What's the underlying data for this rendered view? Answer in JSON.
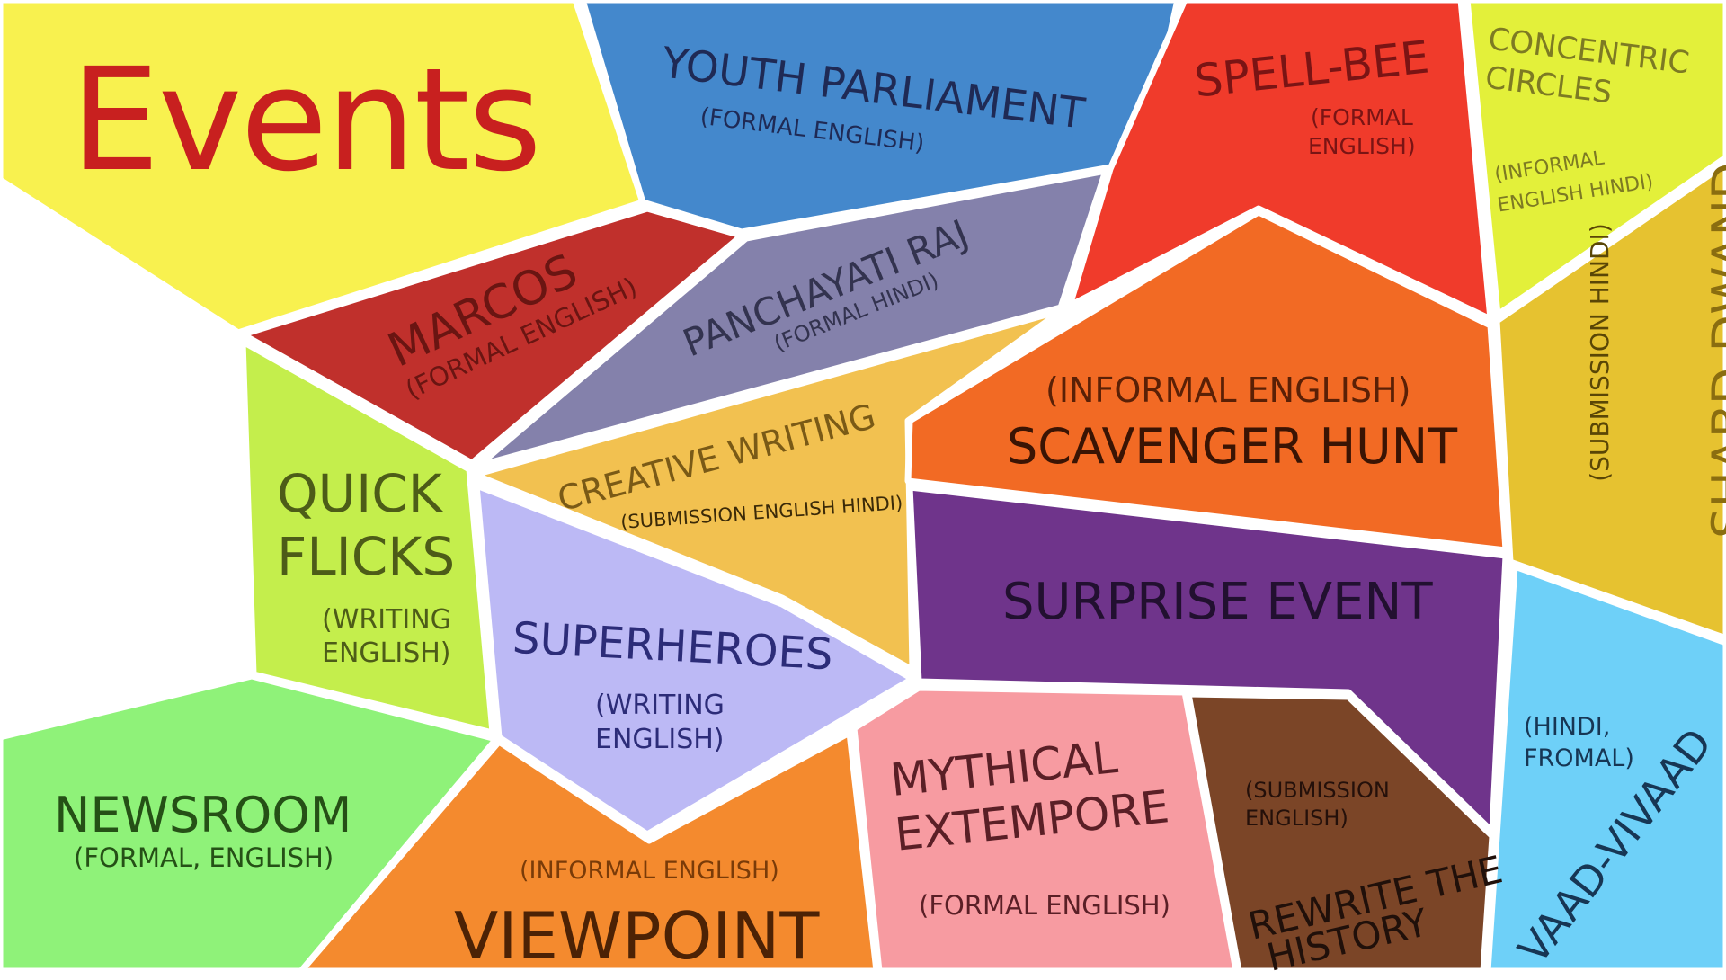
{
  "title": "Events",
  "colors": {
    "title_red": "#c8201f",
    "yellow": "#f8f14f",
    "blue": "#4488cc",
    "red": "#f03b2b",
    "lime": "#e3f03a",
    "dark_red": "#c0302c",
    "slate_purple": "#8481ab",
    "golden": "#f2c150",
    "orange": "#f26a24",
    "light_green": "#c4ee4c",
    "lavender": "#bcb9f5",
    "purple": "#6f348b",
    "mustard": "#e6c230",
    "green": "#8ff279",
    "orange2": "#f48a2e",
    "pink": "#f79ba1",
    "brown": "#7b4527",
    "sky": "#6ed0f8"
  },
  "events": {
    "youth_parliament": {
      "name": "YOUTH PARLIAMENT",
      "type": "(FORMAL ENGLISH)"
    },
    "spell_bee": {
      "name": "SPELL-BEE",
      "type_line1": "(FORMAL",
      "type_line2": "ENGLISH)"
    },
    "concentric_circles": {
      "name_line1": "CONCENTRIC",
      "name_line2": "CIRCLES",
      "type_line1": "(INFORMAL",
      "type_line2": "ENGLISH HINDI)"
    },
    "marcos": {
      "name": "MARCOS",
      "type": "(FORMAL ENGLISH)"
    },
    "panchayati_raj": {
      "name": "PANCHAYATI RAJ",
      "type": "(FORMAL HINDI)"
    },
    "creative_writing": {
      "name": "CREATIVE WRITING",
      "type": "(SUBMISSION ENGLISH HINDI)"
    },
    "scavenger_hunt": {
      "name": "SCAVENGER HUNT",
      "type": "(INFORMAL ENGLISH)"
    },
    "shabd_dwand": {
      "name": "SHABD DWAND",
      "type": "(SUBMISSION HINDI)"
    },
    "quick_flicks": {
      "name_line1": "QUICK",
      "name_line2": "FLICKS",
      "type_line1": "(WRITING",
      "type_line2": "ENGLISH)"
    },
    "superheroes": {
      "name": "SUPERHEROES",
      "type_line1": "(WRITING",
      "type_line2": "ENGLISH)"
    },
    "surprise_event": {
      "name": "SURPRISE EVENT"
    },
    "newsroom": {
      "name": "NEWSROOM",
      "type": "(FORMAL, ENGLISH)"
    },
    "viewpoint": {
      "name": "VIEWPOINT",
      "type": "(INFORMAL ENGLISH)"
    },
    "mythical_extempore": {
      "name_line1": "MYTHICAL",
      "name_line2": "EXTEMPORE",
      "type": "(FORMAL ENGLISH)"
    },
    "rewrite_history": {
      "name_line1": "REWRITE THE",
      "name_line2": "HISTORY",
      "type_line1": "(SUBMISSION",
      "type_line2": "ENGLISH)"
    },
    "vaad_vivaad": {
      "name": "VAAD-VIVAAD",
      "type_line1": "(HINDI,",
      "type_line2": "FROMAL)"
    }
  }
}
